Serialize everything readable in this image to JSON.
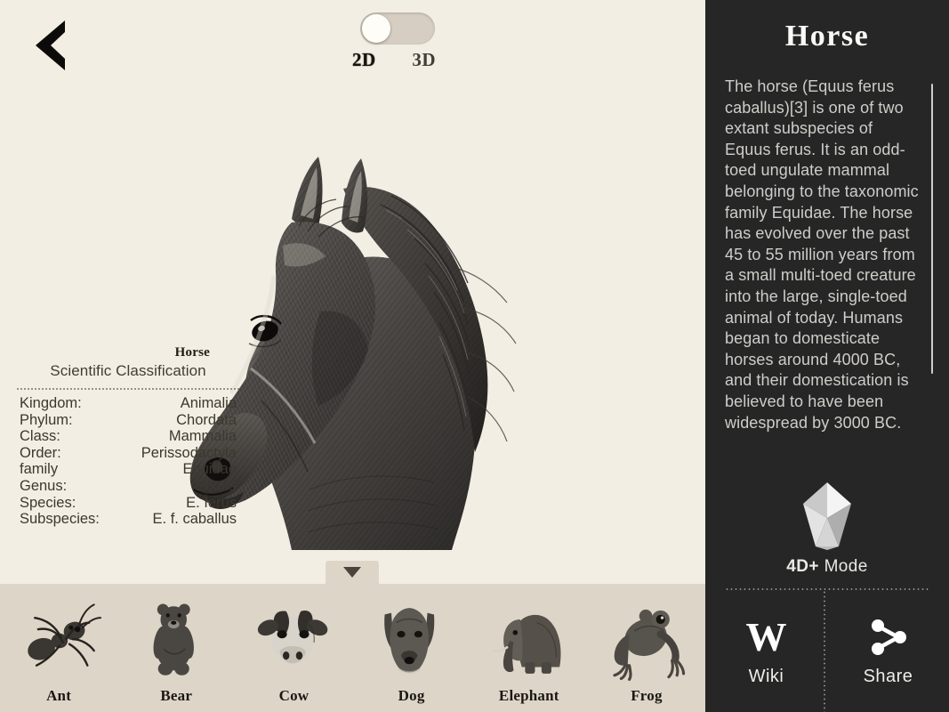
{
  "main": {
    "back_icon": "chevron-left-icon",
    "dimension_toggle": {
      "state": "2D",
      "left_label": "2D",
      "right_label": "3D"
    },
    "illustration": {
      "subject": "horse-head-pencil-sketch",
      "alt": "Horse"
    },
    "taxonomy": {
      "title": "Horse",
      "subtitle": "Scientific Classification",
      "rows": [
        {
          "key": "Kingdom:",
          "value": "Animalia"
        },
        {
          "key": "Phylum:",
          "value": "Chordata"
        },
        {
          "key": "Class:",
          "value": "Mammalia"
        },
        {
          "key": "Order:",
          "value": "Perissodactyla"
        },
        {
          "key": "family",
          "value": "Equidae"
        },
        {
          "key": "Genus:",
          "value": "Equus"
        },
        {
          "key": "Species:",
          "value": "E. ferus"
        },
        {
          "key": "Subspecies:",
          "value": "E. f. caballus"
        }
      ]
    },
    "collapse_tab_icon": "triangle-down-icon",
    "carousel": [
      {
        "label": "Ant",
        "icon": "ant-icon"
      },
      {
        "label": "Bear",
        "icon": "bear-icon"
      },
      {
        "label": "Cow",
        "icon": "cow-icon"
      },
      {
        "label": "Dog",
        "icon": "dog-icon"
      },
      {
        "label": "Elephant",
        "icon": "elephant-icon"
      },
      {
        "label": "Frog",
        "icon": "frog-icon"
      }
    ]
  },
  "sidebar": {
    "title": "Horse",
    "description": "The horse (Equus ferus caballus)[3] is one of two extant subspecies of Equus ferus. It is an odd-toed ungulate mammal belonging to the taxonomic family Equidae. The horse has evolved over the past 45 to 55 million years from a small multi-toed creature into the large, single-toed animal of today. Humans began to domesticate horses around 4000 BC, and their domestication is believed to have been widespread by 3000 BC.",
    "mode": {
      "icon": "crystal-icon",
      "label_bold": "4D+",
      "label_rest": " Mode"
    },
    "actions": [
      {
        "label": "Wiki",
        "icon": "wikipedia-w-icon"
      },
      {
        "label": "Share",
        "icon": "share-nodes-icon"
      }
    ]
  },
  "colors": {
    "canvas": "#f2eee3",
    "carousel_strip": "#ddd6c8",
    "sidebar": "#262626",
    "ink": "#1b1713",
    "sidebar_text": "#cfcdc9"
  }
}
